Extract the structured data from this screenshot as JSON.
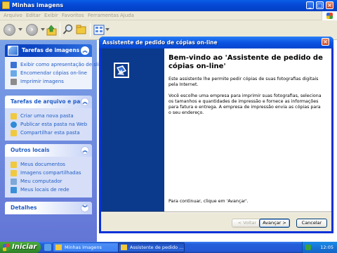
{
  "explorer": {
    "title": "Minhas imagens",
    "menu": [
      "Arquivo",
      "Editar",
      "Exibir",
      "Favoritos",
      "Ferramentas",
      "Ajuda"
    ]
  },
  "taskpane": {
    "picture_tasks": {
      "title": "Tarefas de imagens",
      "items": [
        "Exibir como apresentação de slides",
        "Encomendar cópias on-line",
        "Imprimir imagens"
      ]
    },
    "file_tasks": {
      "title": "Tarefas de arquivo e pasta",
      "items": [
        "Criar uma nova pasta",
        "Publicar esta pasta na Web",
        "Compartilhar esta pasta"
      ]
    },
    "other_places": {
      "title": "Outros locais",
      "items": [
        "Meus documentos",
        "Imagens compartilhadas",
        "Meu computador",
        "Meus locais de rede"
      ]
    },
    "details": {
      "title": "Detalhes"
    }
  },
  "wizard": {
    "title": "Assistente de pedido de cópias on-line",
    "heading": "Bem-vindo ao 'Assistente de pedido de cópias on-line'",
    "paragraph1": "Este assistente lhe permite pedir cópias de suas fotografias digitais pela Internet.",
    "paragraph2": "Você escolhe uma empresa para imprimir suas fotografias, seleciona os tamanhos e quantidades de impressão e fornece as informações para fatura e entrega. A empresa de impressão envia as cópias para o seu endereço.",
    "continue_text": "Para continuar, clique em 'Avançar'.",
    "back_label": "< Voltar",
    "next_label": "Avançar >",
    "cancel_label": "Cancelar"
  },
  "taskbar": {
    "start_label": "Iniciar",
    "tasks": [
      "Minhas imagens",
      "Assistente de pedido ..."
    ],
    "clock": "12:05"
  },
  "colors": {
    "xp_blue": "#0548d4",
    "taskpane_gradient_top": "#7ba2e7",
    "link_blue": "#215dc6",
    "start_green": "#3c9a34"
  }
}
